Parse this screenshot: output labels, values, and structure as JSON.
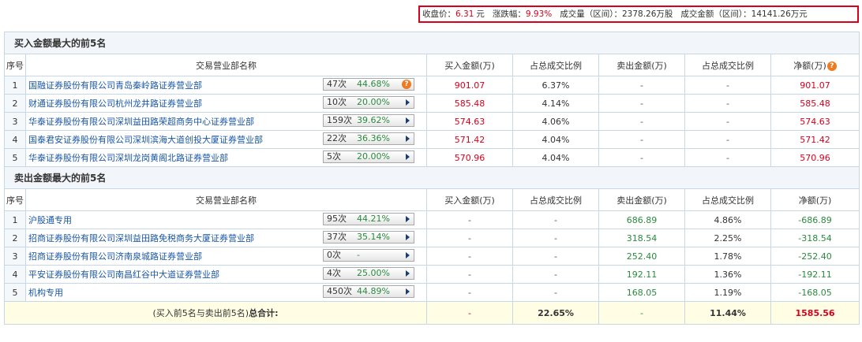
{
  "summary": {
    "close_label": "收盘价：",
    "close_value": "6.31",
    "close_unit": "元",
    "change_label": "涨跌幅：",
    "change_value": "9.93%",
    "volume_text": "成交量（区间）：2378.26万股",
    "amount_text": "成交金额（区间）：14141.26万元"
  },
  "columns": {
    "seq": "序号",
    "broker": "交易营业部名称",
    "buy_amount": "买入金额(万)",
    "buy_ratio": "占总成交比例",
    "sell_amount": "卖出金额(万)",
    "sell_ratio": "占总成交比例",
    "net": "净额(万)",
    "help_icon": "?"
  },
  "buy_section": {
    "title": "买入金额最大的前5名",
    "rows": [
      {
        "seq": "1",
        "name": "国融证券股份有限公司青岛秦岭路证券营业部",
        "count": "47次",
        "pct": "44.68%",
        "buy": "901.07",
        "buy_ratio": "6.37%",
        "sell": "-",
        "sell_ratio": "-",
        "net": "901.07",
        "has_help": true
      },
      {
        "seq": "2",
        "name": "财通证券股份有限公司杭州龙井路证券营业部",
        "count": "10次",
        "pct": "20.00%",
        "buy": "585.48",
        "buy_ratio": "4.14%",
        "sell": "-",
        "sell_ratio": "-",
        "net": "585.48",
        "has_help": false
      },
      {
        "seq": "3",
        "name": "华泰证券股份有限公司深圳益田路荣超商务中心证券营业部",
        "count": "159次",
        "pct": "39.62%",
        "buy": "574.63",
        "buy_ratio": "4.06%",
        "sell": "-",
        "sell_ratio": "-",
        "net": "574.63",
        "has_help": false
      },
      {
        "seq": "4",
        "name": "国泰君安证券股份有限公司深圳滨海大道创投大厦证券营业部",
        "count": "22次",
        "pct": "36.36%",
        "buy": "571.42",
        "buy_ratio": "4.04%",
        "sell": "-",
        "sell_ratio": "-",
        "net": "571.42",
        "has_help": false
      },
      {
        "seq": "5",
        "name": "华泰证券股份有限公司深圳龙岗黄阁北路证券营业部",
        "count": "5次",
        "pct": "20.00%",
        "buy": "570.96",
        "buy_ratio": "4.04%",
        "sell": "-",
        "sell_ratio": "-",
        "net": "570.96",
        "has_help": false
      }
    ]
  },
  "sell_section": {
    "title": "卖出金额最大的前5名",
    "rows": [
      {
        "seq": "1",
        "name": "沪股通专用",
        "count": "95次",
        "pct": "44.21%",
        "buy": "-",
        "buy_ratio": "-",
        "sell": "686.89",
        "sell_ratio": "4.86%",
        "net": "-686.89"
      },
      {
        "seq": "2",
        "name": "招商证券股份有限公司深圳益田路免税商务大厦证券营业部",
        "count": "37次",
        "pct": "35.14%",
        "buy": "-",
        "buy_ratio": "-",
        "sell": "318.54",
        "sell_ratio": "2.25%",
        "net": "-318.54"
      },
      {
        "seq": "3",
        "name": "招商证券股份有限公司济南泉城路证券营业部",
        "count": "0次",
        "pct": "-",
        "buy": "-",
        "buy_ratio": "-",
        "sell": "252.40",
        "sell_ratio": "1.78%",
        "net": "-252.40"
      },
      {
        "seq": "4",
        "name": "平安证券股份有限公司南昌红谷中大道证券营业部",
        "count": "4次",
        "pct": "25.00%",
        "buy": "-",
        "buy_ratio": "-",
        "sell": "192.11",
        "sell_ratio": "1.36%",
        "net": "-192.11"
      },
      {
        "seq": "5",
        "name": "机构专用",
        "count": "450次",
        "pct": "44.89%",
        "buy": "-",
        "buy_ratio": "-",
        "sell": "168.05",
        "sell_ratio": "1.19%",
        "net": "-168.05"
      }
    ]
  },
  "total": {
    "label_prefix": "(买入前5名与卖出前5名)",
    "label_bold": "总合计:",
    "buy": "-",
    "buy_ratio": "22.65%",
    "sell": "-",
    "sell_ratio": "11.44%",
    "net": "1585.56"
  },
  "colors": {
    "red": "#d9001b",
    "green": "#2a8a3e",
    "border": "#c6d7e6",
    "link": "#1a57a6",
    "total_bg": "#fffde3"
  }
}
